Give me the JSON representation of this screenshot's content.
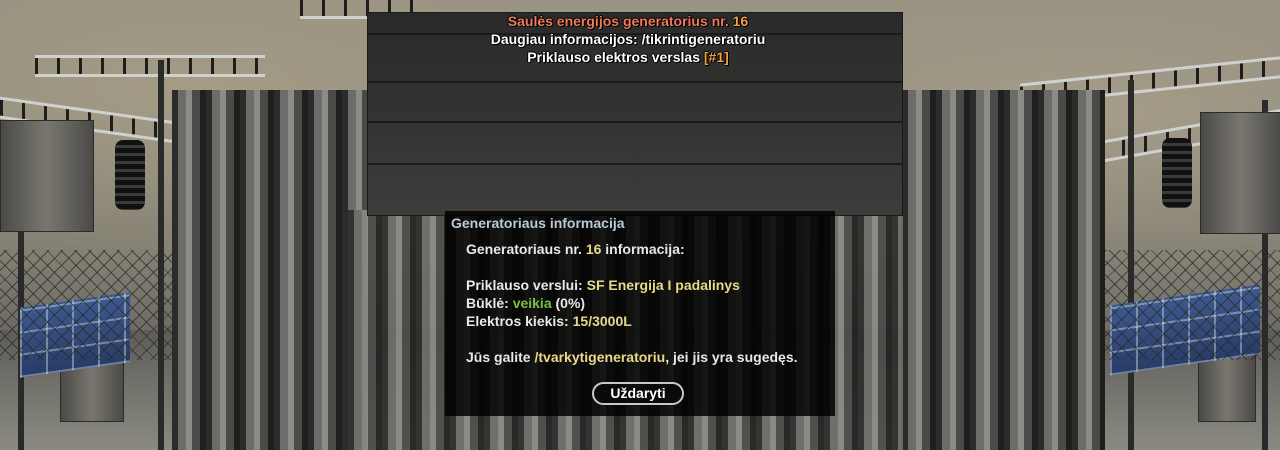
{
  "label3d": {
    "line1_prefix": "Saulės energijos generatorius nr.",
    "line1_number": "16",
    "line2": "Daugiau informacijos: /tikrintigeneratoriu",
    "line3_prefix": "Priklauso elektros verslas",
    "line3_tag": "[#1]",
    "colors": {
      "title": "#f07a5a",
      "text": "#ffffff",
      "tag": "#f0a040"
    }
  },
  "dialog": {
    "title": "Generatoriaus informacija",
    "heading_prefix": "Generatoriaus nr.",
    "heading_number": "16",
    "heading_suffix": "informacija:",
    "owner_label": "Priklauso verslui:",
    "owner_value": "SF Energija I padalinys",
    "status_label": "Būklė:",
    "status_value": "veikia",
    "status_percent": "(0%)",
    "amount_label": "Elektros kiekis:",
    "amount_value": "15/3000L",
    "note_prefix": "Jūs galite",
    "note_command": "/tvarkytigeneratoriu",
    "note_suffix": ", jei jis yra sugedęs.",
    "close_label": "Uždaryti",
    "colors": {
      "title": "#b9c9d8",
      "highlight": "#e8d98a",
      "status_ok": "#7bc043"
    }
  }
}
